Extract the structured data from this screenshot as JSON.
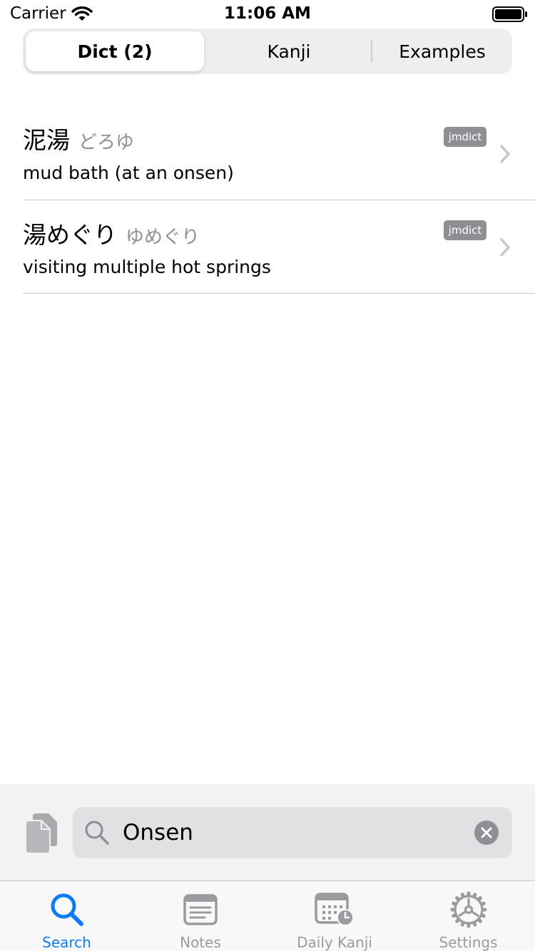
{
  "status_bar": {
    "carrier": "Carrier",
    "time": "11:06 AM"
  },
  "segments": [
    {
      "label": "Dict (2)",
      "selected": true
    },
    {
      "label": "Kanji",
      "selected": false
    },
    {
      "label": "Examples",
      "selected": false
    }
  ],
  "results": [
    {
      "headword": "泥湯",
      "reading": "どろゆ",
      "gloss": "mud bath (at an onsen)",
      "source": "jmdict"
    },
    {
      "headword": "湯めぐり",
      "reading": "ゆめぐり",
      "gloss": "visiting multiple hot springs",
      "source": "jmdict"
    }
  ],
  "search": {
    "value": "Onsen"
  },
  "tabs": [
    {
      "label": "Search",
      "icon": "search-icon",
      "active": true
    },
    {
      "label": "Notes",
      "icon": "notes-icon",
      "active": false
    },
    {
      "label": "Daily Kanji",
      "icon": "calendar-icon",
      "active": false
    },
    {
      "label": "Settings",
      "icon": "gear-icon",
      "active": false
    }
  ],
  "colors": {
    "accent": "#0a7aff",
    "inactive": "#9a9a9f",
    "badge": "#8e8e93"
  }
}
